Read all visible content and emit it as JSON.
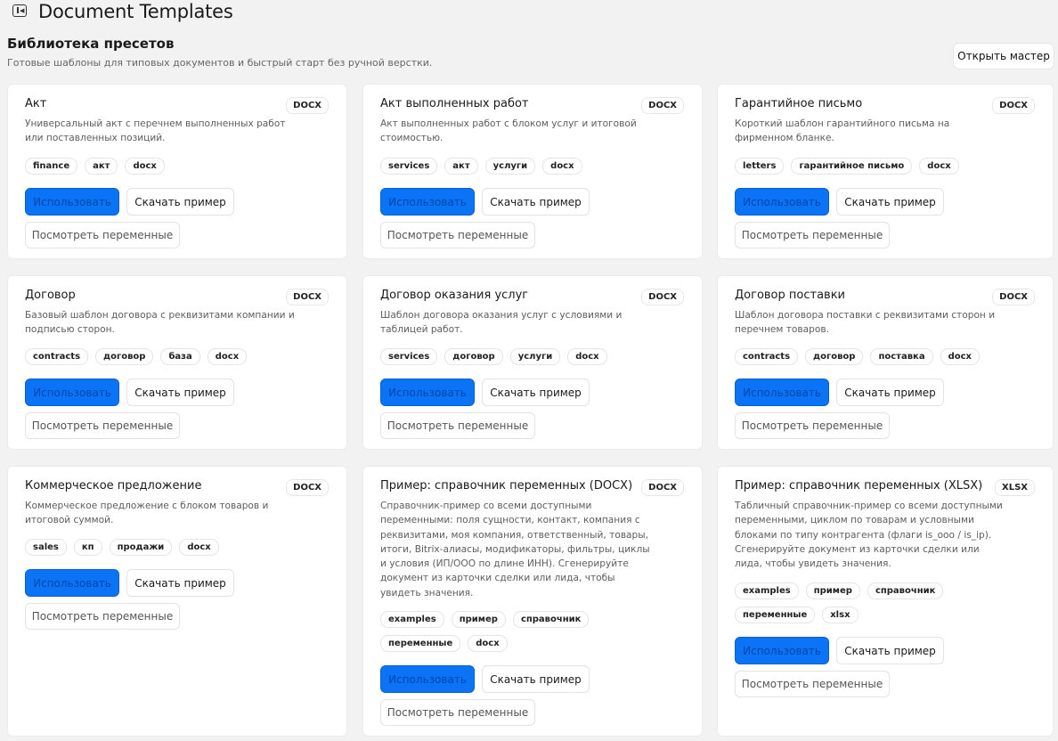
{
  "app": {
    "title": "Document Templates"
  },
  "library": {
    "title": "Библиотека пресетов",
    "subtitle": "Готовые шаблоны для типовых документов и быстрый старт без ручной верстки.",
    "wizard_label": "Открыть мастер"
  },
  "actions": {
    "use": "Использовать",
    "download": "Скачать пример",
    "vars": "Посмотреть переменные"
  },
  "cards": [
    {
      "title": "Акт",
      "badge": "DOCX",
      "desc": "Универсальный акт с перечнем выполненных работ или поставленных позиций.",
      "tags": [
        "finance",
        "акт",
        "docx"
      ]
    },
    {
      "title": "Акт выполненных работ",
      "badge": "DOCX",
      "desc": "Акт выполненных работ с блоком услуг и итоговой стоимостью.",
      "tags": [
        "services",
        "акт",
        "услуги",
        "docx"
      ]
    },
    {
      "title": "Гарантийное письмо",
      "badge": "DOCX",
      "desc": "Короткий шаблон гарантийного письма на фирменном бланке.",
      "tags": [
        "letters",
        "гарантийное письмо",
        "docx"
      ]
    },
    {
      "title": "Договор",
      "badge": "DOCX",
      "desc": "Базовый шаблон договора с реквизитами компании и подписью сторон.",
      "tags": [
        "contracts",
        "договор",
        "база",
        "docx"
      ]
    },
    {
      "title": "Договор оказания услуг",
      "badge": "DOCX",
      "desc": "Шаблон договора оказания услуг с условиями и таблицей работ.",
      "tags": [
        "services",
        "договор",
        "услуги",
        "docx"
      ]
    },
    {
      "title": "Договор поставки",
      "badge": "DOCX",
      "desc": "Шаблон договора поставки с реквизитами сторон и перечнем товаров.",
      "tags": [
        "contracts",
        "договор",
        "поставка",
        "docx"
      ]
    },
    {
      "title": "Коммерческое предложение",
      "badge": "DOCX",
      "desc": "Коммерческое предложение с блоком товаров и итоговой суммой.",
      "tags": [
        "sales",
        "кп",
        "продажи",
        "docx"
      ]
    },
    {
      "title": "Пример: справочник переменных (DOCX)",
      "badge": "DOCX",
      "desc": "Справочник-пример со всеми доступными переменными: поля сущности, контакт, компания с реквизитами, моя компания, ответственный, товары, итоги, Bitrix-алиасы, модификаторы, фильтры, циклы и условия (ИП/ООО по длине ИНН). Сгенерируйте документ из карточки сделки или лида, чтобы увидеть значения.",
      "tags": [
        "examples",
        "пример",
        "справочник",
        "переменные",
        "docx"
      ]
    },
    {
      "title": "Пример: справочник переменных (XLSX)",
      "badge": "XLSX",
      "desc": "Табличный справочник-пример со всеми доступными переменными, циклом по товарам и условными блоками по типу контрагента (флаги is_ooo / is_ip). Сгенерируйте документ из карточки сделки или лида, чтобы увидеть значения.",
      "tags": [
        "examples",
        "пример",
        "справочник",
        "переменные",
        "xlsx"
      ]
    }
  ]
}
